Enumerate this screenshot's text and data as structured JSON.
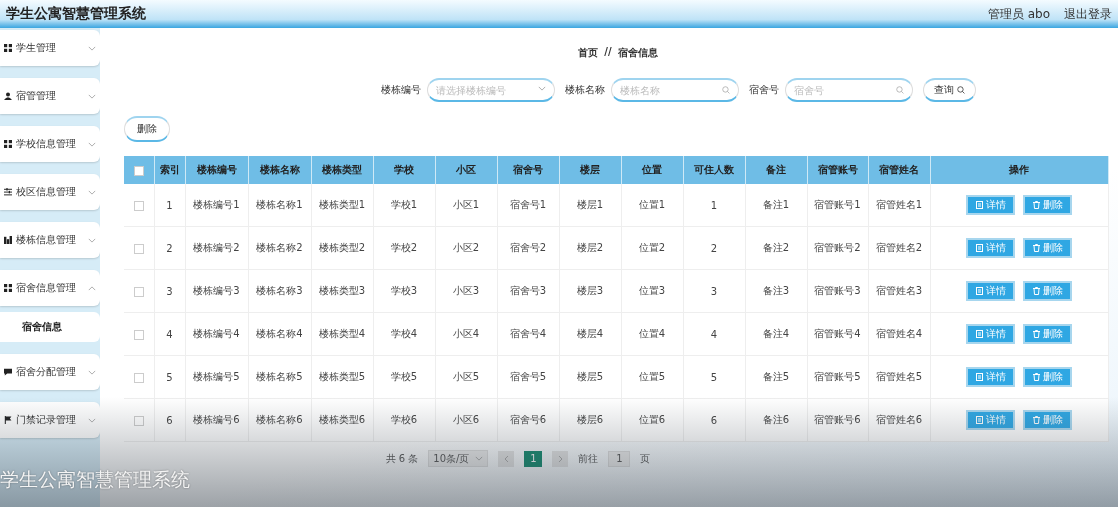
{
  "header": {
    "title": "学生公寓智慧管理系统",
    "user": "管理员 abo",
    "logout": "退出登录"
  },
  "sidebar": {
    "items": [
      {
        "label": "学生管理",
        "kind": "grid",
        "expanded": false
      },
      {
        "label": "宿管管理",
        "kind": "person",
        "expanded": false
      },
      {
        "label": "学校信息管理",
        "kind": "grid",
        "expanded": false
      },
      {
        "label": "校区信息管理",
        "kind": "sliders",
        "expanded": false
      },
      {
        "label": "楼栋信息管理",
        "kind": "chart",
        "expanded": false
      },
      {
        "label": "宿舍信息管理",
        "kind": "grid",
        "expanded": true,
        "children": [
          {
            "label": "宿舍信息",
            "selected": true
          }
        ]
      },
      {
        "label": "宿舍分配管理",
        "kind": "chat",
        "expanded": false
      },
      {
        "label": "门禁记录管理",
        "kind": "flag",
        "expanded": false
      }
    ]
  },
  "breadcrumb": {
    "items": [
      "首页",
      "宿舍信息"
    ],
    "separator": "//"
  },
  "filters": [
    {
      "label": "楼栋编号",
      "placeholder": "请选择楼栋编号",
      "kind": "select"
    },
    {
      "label": "楼栋名称",
      "placeholder": "楼栋名称",
      "kind": "search"
    },
    {
      "label": "宿舍号",
      "placeholder": "宿舍号",
      "kind": "search"
    }
  ],
  "query_button": "查询",
  "delete_button": "删除",
  "table": {
    "header_checked": false,
    "columns": [
      "索引",
      "楼栋编号",
      "楼栋名称",
      "楼栋类型",
      "学校",
      "小区",
      "宿舍号",
      "楼层",
      "位置",
      "可住人数",
      "备注",
      "宿管账号",
      "宿管姓名",
      "操作"
    ],
    "rows": [
      {
        "checked": false,
        "cells": [
          "1",
          "楼栋编号1",
          "楼栋名称1",
          "楼栋类型1",
          "学校1",
          "小区1",
          "宿舍号1",
          "楼层1",
          "位置1",
          "1",
          "备注1",
          "宿管账号1",
          "宿管姓名1"
        ],
        "actions": [
          "详情",
          "删除"
        ]
      },
      {
        "checked": false,
        "cells": [
          "2",
          "楼栋编号2",
          "楼栋名称2",
          "楼栋类型2",
          "学校2",
          "小区2",
          "宿舍号2",
          "楼层2",
          "位置2",
          "2",
          "备注2",
          "宿管账号2",
          "宿管姓名2"
        ],
        "actions": [
          "详情",
          "删除"
        ]
      },
      {
        "checked": false,
        "cells": [
          "3",
          "楼栋编号3",
          "楼栋名称3",
          "楼栋类型3",
          "学校3",
          "小区3",
          "宿舍号3",
          "楼层3",
          "位置3",
          "3",
          "备注3",
          "宿管账号3",
          "宿管姓名3"
        ],
        "actions": [
          "详情",
          "删除"
        ]
      },
      {
        "checked": false,
        "cells": [
          "4",
          "楼栋编号4",
          "楼栋名称4",
          "楼栋类型4",
          "学校4",
          "小区4",
          "宿舍号4",
          "楼层4",
          "位置4",
          "4",
          "备注4",
          "宿管账号4",
          "宿管姓名4"
        ],
        "actions": [
          "详情",
          "删除"
        ]
      },
      {
        "checked": false,
        "cells": [
          "5",
          "楼栋编号5",
          "楼栋名称5",
          "楼栋类型5",
          "学校5",
          "小区5",
          "宿舍号5",
          "楼层5",
          "位置5",
          "5",
          "备注5",
          "宿管账号5",
          "宿管姓名5"
        ],
        "actions": [
          "详情",
          "删除"
        ]
      },
      {
        "checked": false,
        "cells": [
          "6",
          "楼栋编号6",
          "楼栋名称6",
          "楼栋类型6",
          "学校6",
          "小区6",
          "宿舍号6",
          "楼层6",
          "位置6",
          "6",
          "备注6",
          "宿管账号6",
          "宿管姓名6"
        ],
        "actions": [
          "详情",
          "删除"
        ]
      }
    ]
  },
  "pagination": {
    "total": "共 6 条",
    "page_size": "10条/页",
    "pages": [
      {
        "label": "1",
        "selected": true
      }
    ],
    "goto_label": "前往",
    "goto_value": "1",
    "goto_suffix": "页"
  },
  "caption": "学生公寓智慧管理系统"
}
